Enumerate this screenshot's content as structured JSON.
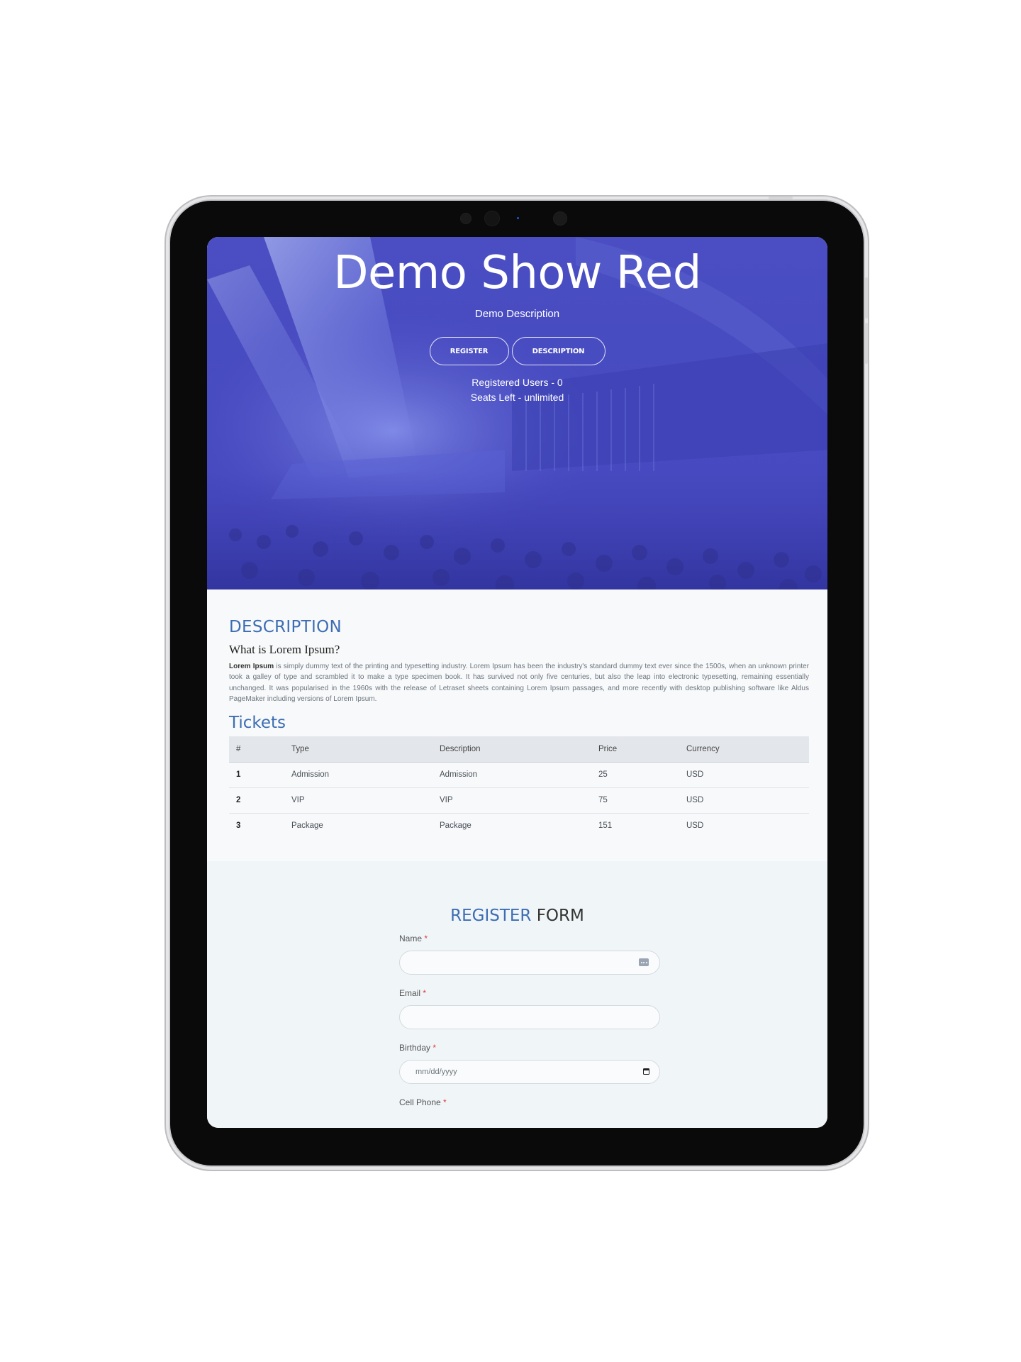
{
  "hero": {
    "title": "Demo Show Red",
    "description": "Demo Description",
    "register_label": "REGISTER",
    "description_label": "DESCRIPTION",
    "registered_users": "Registered Users - 0",
    "seats_left": "Seats Left - unlimited"
  },
  "description": {
    "heading": "DESCRIPTION",
    "subheading": "What is Lorem Ipsum?",
    "lead": "Lorem Ipsum",
    "body": " is simply dummy text of the printing and typesetting industry. Lorem Ipsum has been the industry's standard dummy text ever since the 1500s, when an unknown printer took a galley of type and scrambled it to make a type specimen book. It has survived not only five centuries, but also the leap into electronic typesetting, remaining essentially unchanged. It was popularised in the 1960s with the release of Letraset sheets containing Lorem Ipsum passages, and more recently with desktop publishing software like Aldus PageMaker including versions of Lorem Ipsum."
  },
  "tickets": {
    "heading": "Tickets",
    "columns": [
      "#",
      "Type",
      "Description",
      "Price",
      "Currency"
    ],
    "rows": [
      {
        "num": "1",
        "type": "Admission",
        "description": "Admission",
        "price": "25",
        "currency": "USD"
      },
      {
        "num": "2",
        "type": "VIP",
        "description": "VIP",
        "price": "75",
        "currency": "USD"
      },
      {
        "num": "3",
        "type": "Package",
        "description": "Package",
        "price": "151",
        "currency": "USD"
      }
    ]
  },
  "form": {
    "title_accent": "REGISTER",
    "title_rest": " FORM",
    "required_mark": "*",
    "name_label": "Name ",
    "email_label": "Email ",
    "birthday_label": "Birthday ",
    "birthday_placeholder": "mm/dd/yyyy",
    "phone_label": "Cell Phone "
  },
  "colors": {
    "accent": "#3c6db3",
    "hero_overlay": "#4a4ec2",
    "required": "#e0393e"
  }
}
